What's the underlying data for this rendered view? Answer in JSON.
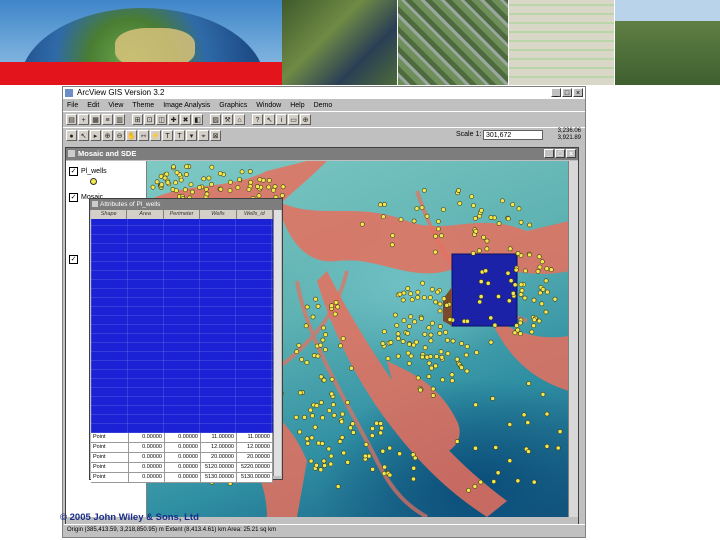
{
  "app": {
    "title": "ArcView GIS Version 3.2",
    "menus": [
      "File",
      "Edit",
      "View",
      "Theme",
      "Image Analysis",
      "Graphics",
      "Window",
      "Help",
      "Demo"
    ],
    "scale_label": "Scale 1:",
    "scale_value": "301,672",
    "coord_readout": [
      "3,236.06",
      "3,921.89"
    ]
  },
  "view": {
    "title": "Mosaic and SDE",
    "layers": [
      "Pl_wells",
      "Mosaic"
    ]
  },
  "attribute_table": {
    "title": "Attributes of Pl_wells",
    "columns": [
      "Shape",
      "Area",
      "Perimeter",
      "Wells",
      "Wells_id"
    ],
    "rows": [
      [
        "Point",
        "0.00000",
        "0.00000",
        "11.00000",
        "11.00000"
      ],
      [
        "Point",
        "0.00000",
        "0.00000",
        "12.00000",
        "12.00000"
      ],
      [
        "Point",
        "0.00000",
        "0.00000",
        "20.00000",
        "20.00000"
      ],
      [
        "Point",
        "0.00000",
        "0.00000",
        "5120.00000",
        "5220.00000"
      ],
      [
        "Point",
        "0.00000",
        "0.00000",
        "5130.00000",
        "5130.00000"
      ]
    ]
  },
  "status_bar": "Origin (385,413.59, 3,218,850.95) m  Extent (8,413.4.61) km  Area: 25.21 sq km",
  "copyright": "© 2005 John Wiley & Sons, Ltd",
  "colors": {
    "map_water": "#5fb3b3",
    "map_land": "#e8705e",
    "points": "#f2e84d",
    "selected": "#1b22a8",
    "title_bar": "#7d7d7d"
  }
}
